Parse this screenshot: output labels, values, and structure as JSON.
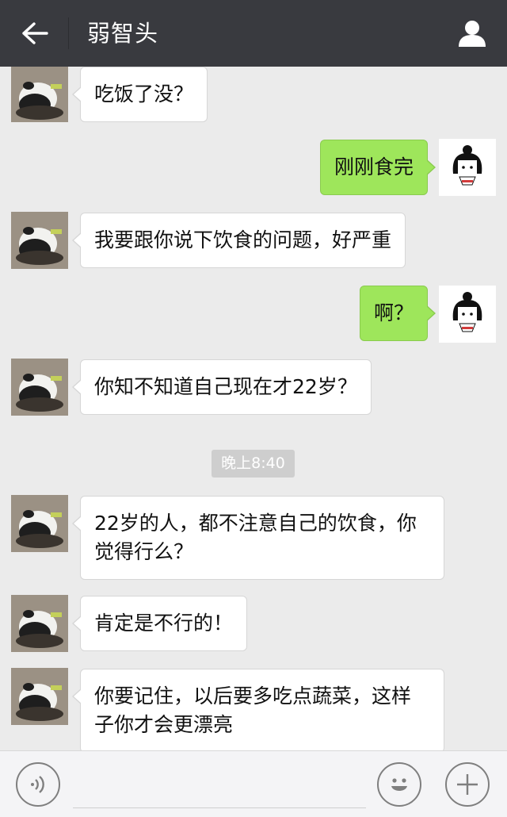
{
  "header": {
    "title": "弱智头",
    "back_icon": "arrow-left-icon",
    "profile_icon": "person-icon"
  },
  "colors": {
    "header_bg": "#393a3f",
    "chat_bg": "#ebebeb",
    "incoming_bubble": "#ffffff",
    "outgoing_bubble": "#9ee65b",
    "timestamp_bg": "#cecece"
  },
  "messages": [
    {
      "side": "left",
      "text": "吃饭了没？"
    },
    {
      "side": "right",
      "text": "刚刚食完"
    },
    {
      "side": "left",
      "text": "我要跟你说下饮食的问题，好严重"
    },
    {
      "side": "right",
      "text": "啊？"
    },
    {
      "side": "left",
      "text": "你知不知道自己现在才22岁？"
    },
    {
      "side": "left",
      "text": "22岁的人，都不注意自己的饮食，你觉得行么？"
    },
    {
      "side": "left",
      "text": "肯定是不行的！"
    },
    {
      "side": "left",
      "text": "你要记住，以后要多吃点蔬菜，这样子你才会更漂亮"
    }
  ],
  "timestamp": "晚上8:40",
  "input_bar": {
    "voice_icon": "voice-icon",
    "emoji_icon": "emoji-icon",
    "plus_icon": "plus-icon",
    "input_value": ""
  }
}
